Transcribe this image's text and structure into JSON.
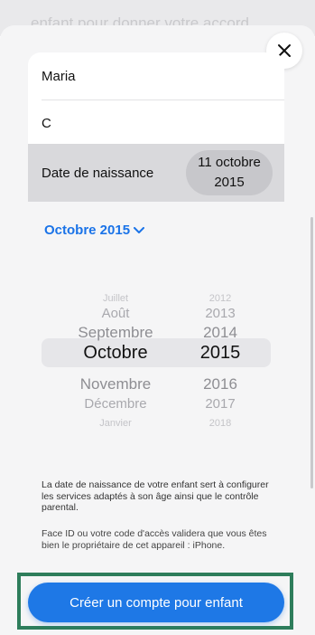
{
  "background": {
    "ghost_text": "enfant pour donner votre accord."
  },
  "form": {
    "first_name": "Maria",
    "last_name": "C",
    "birthdate_label": "Date de naissance",
    "birthdate_value_day_month": "11 octobre",
    "birthdate_value_year": "2015"
  },
  "calendar": {
    "month_year": "Octobre 2015"
  },
  "picker": {
    "months": [
      "Juillet",
      "Août",
      "Septembre",
      "Octobre",
      "Novembre",
      "Décembre",
      "Janvier"
    ],
    "years": [
      "2012",
      "2013",
      "2014",
      "2015",
      "2016",
      "2017",
      "2018"
    ],
    "selected_index": 3
  },
  "info": {
    "paragraph1": "La date de naissance de votre enfant sert à configurer les services adaptés à son âge ainsi que le contrôle parental.",
    "paragraph2": "Face ID ou votre code d'accès validera que vous êtes bien le propriétaire de cet appareil : iPhone."
  },
  "cta": {
    "label": "Créer un compte pour enfant"
  },
  "colors": {
    "accent": "#1e78e6",
    "highlight_border": "#2e7d5b"
  }
}
